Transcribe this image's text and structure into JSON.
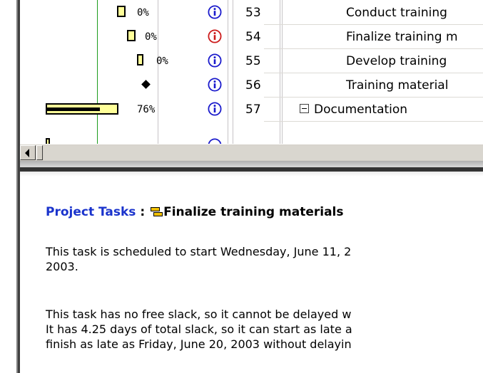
{
  "gantt": {
    "rows": [
      {
        "percent": "0%",
        "id": "53",
        "task": "Conduct training",
        "info_color": "#1a1acc",
        "bar_type": "bar"
      },
      {
        "percent": "0%",
        "id": "54",
        "task": "Finalize training m",
        "info_color": "#cc1a1a",
        "bar_type": "bar"
      },
      {
        "percent": "0%",
        "id": "55",
        "task": "Develop training",
        "info_color": "#1a1acc",
        "bar_type": "bar"
      },
      {
        "percent": "",
        "id": "56",
        "task": "Training material",
        "info_color": "#1a1acc",
        "bar_type": "milestone"
      },
      {
        "percent": "76%",
        "id": "57",
        "task": "Documentation",
        "info_color": "#1a1acc",
        "bar_type": "summary",
        "progress": 0.76
      }
    ],
    "icon": "info-icon"
  },
  "help": {
    "section_link": "Project Tasks",
    "separator": ":",
    "task_title": "Finalize training materials",
    "paragraph1": [
      "This task is scheduled to start Wednesday, June 11, 2",
      "2003."
    ],
    "paragraph2": [
      "This task has no free slack, so it cannot be delayed w",
      "It has 4.25 days of total slack, so it can start as late a",
      "finish as late as Friday, June 20, 2003 without delayin"
    ]
  },
  "colors": {
    "link": "#1a33cc",
    "bar_fill": "#ffff99",
    "info_blue": "#1a1acc",
    "info_red": "#cc1a1a"
  }
}
